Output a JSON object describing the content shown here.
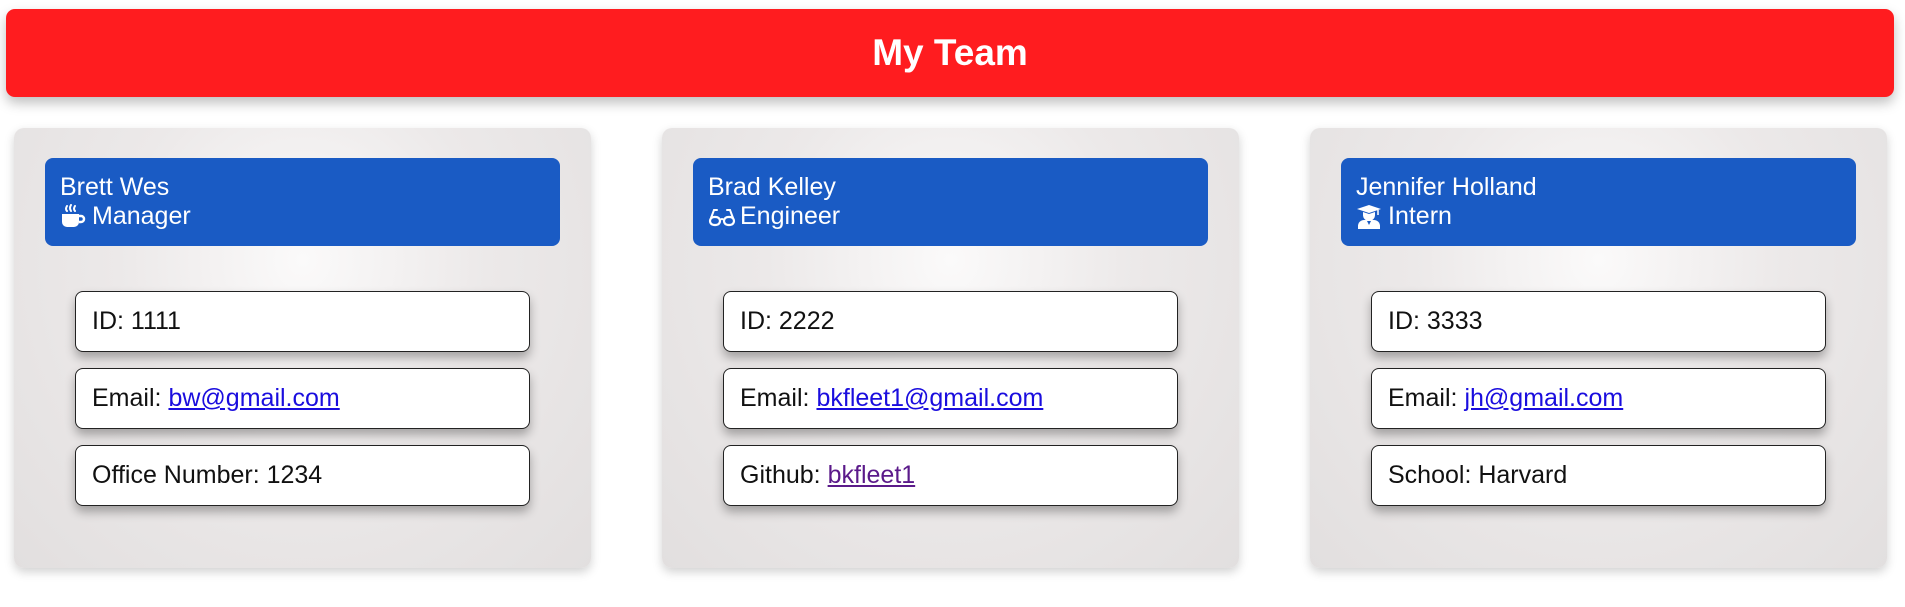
{
  "header": {
    "title": "My Team"
  },
  "cards": [
    {
      "name": "Brett Wes",
      "role": "Manager",
      "role_icon": "coffee-icon",
      "id_text": "ID: 1111",
      "email_label": "Email:",
      "email": "bw@gmail.com",
      "extra_label": "Office Number: 1234"
    },
    {
      "name": "Brad Kelley",
      "role": "Engineer",
      "role_icon": "glasses-icon",
      "id_text": "ID: 2222",
      "email_label": "Email:",
      "email": "bkfleet1@gmail.com",
      "extra_label": "Github:",
      "extra_link": "bkfleet1"
    },
    {
      "name": "Jennifer Holland",
      "role": "Intern",
      "role_icon": "graduate-icon",
      "id_text": "ID: 3333",
      "email_label": "Email:",
      "email": "jh@gmail.com",
      "extra_label": "School: Harvard"
    }
  ],
  "colors": {
    "header_bg": "#ff1c1f",
    "card_head_bg": "#1a5bc4",
    "link": "#1a0dde",
    "visited_link": "#5b1a8a"
  }
}
